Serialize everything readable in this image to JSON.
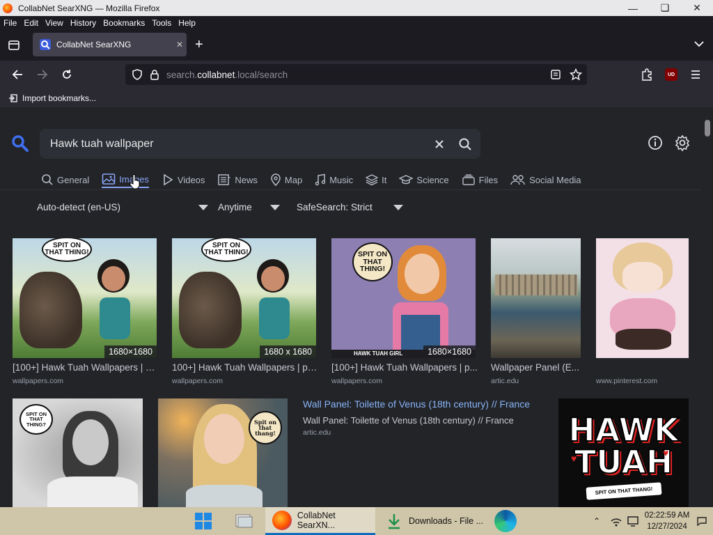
{
  "window": {
    "title": "CollabNet SearXNG — Mozilla Firefox"
  },
  "menu": [
    "File",
    "Edit",
    "View",
    "History",
    "Bookmarks",
    "Tools",
    "Help"
  ],
  "tab": {
    "label": "CollabNet SearXNG"
  },
  "url": {
    "host_prefix": "search.",
    "host": "collabnet",
    "host_suffix": ".local/search"
  },
  "bookmarks": {
    "import_label": "Import bookmarks..."
  },
  "search": {
    "query": "Hawk tuah wallpaper"
  },
  "categories": [
    {
      "label": "General",
      "icon": "search-icon"
    },
    {
      "label": "Images",
      "icon": "image-icon",
      "active": true
    },
    {
      "label": "Videos",
      "icon": "play-icon"
    },
    {
      "label": "News",
      "icon": "newspaper-icon"
    },
    {
      "label": "Map",
      "icon": "map-pin-icon"
    },
    {
      "label": "Music",
      "icon": "music-icon"
    },
    {
      "label": "It",
      "icon": "layers-icon"
    },
    {
      "label": "Science",
      "icon": "graduation-icon"
    },
    {
      "label": "Files",
      "icon": "files-icon"
    },
    {
      "label": "Social Media",
      "icon": "people-icon"
    }
  ],
  "filters": {
    "language": "Auto-detect (en-US)",
    "time": "Anytime",
    "safesearch": "SafeSearch: Strict"
  },
  "results": [
    {
      "title": "[100+] Hawk Tuah Wallpapers | W...",
      "source": "wallpapers.com",
      "resolution": "1680×1680",
      "bubble": "SPIT ON THAT THING!"
    },
    {
      "title": "100+] Hawk Tuah Wallpapers | pa...",
      "source": "wallpapers.com",
      "resolution": "1680 x 1680",
      "bubble": "SPIT ON THAT THING!"
    },
    {
      "title": "[100+] Hawk Tuah Wallpapers | p...",
      "source": "wallpapers.com",
      "resolution": "1680×1680",
      "bubble": "SPIT ON THAT THING!",
      "caption": "HAWK TUAH GIRL"
    },
    {
      "title": "Wallpaper Panel (E...",
      "source": "artic.edu"
    },
    {
      "title": "",
      "source": "www.pinterest.com"
    },
    {
      "bubble": "SPIT ON THAT THING?"
    },
    {
      "bubble": "Spit on that thang!"
    },
    {
      "title": "Wall Panel: Toilette of Venus (18th century) // France",
      "subtitle": "Wall Panel: Toilette of Venus (18th century) // France",
      "source": "artic.edu"
    },
    {
      "logo_line1": "HAWK",
      "logo_line2": "TUAH",
      "logo_tag": "SPIT ON THAT THANG!"
    }
  ],
  "taskbar": {
    "firefox_label": "CollabNet SearXN...",
    "downloads_label": "Downloads - File ...",
    "time": "02:22:59 AM",
    "date": "12/27/2024"
  },
  "colors": {
    "accent": "#8aa4f5",
    "link": "#8ab4f8",
    "bg": "#222428"
  }
}
